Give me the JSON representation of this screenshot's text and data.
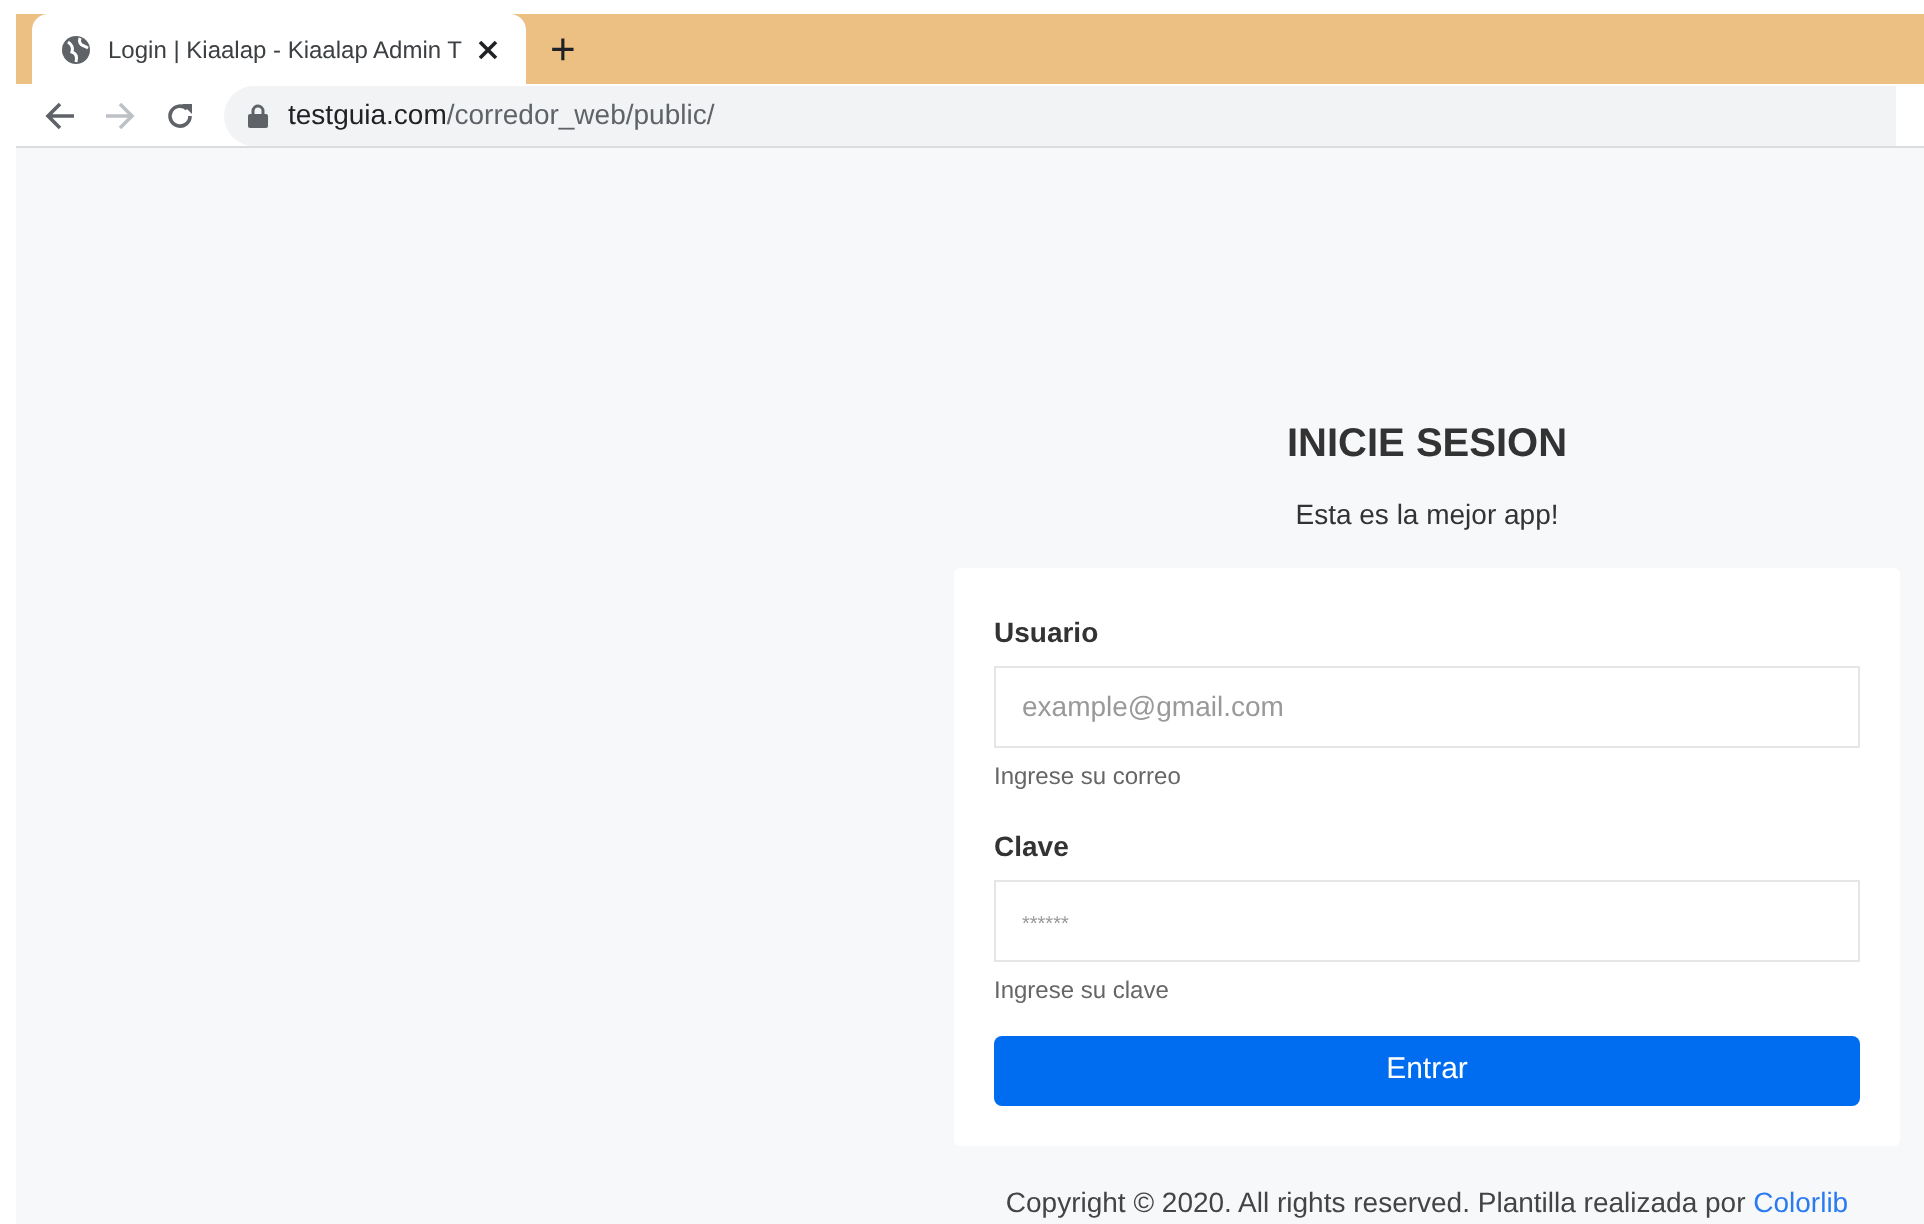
{
  "browser": {
    "tab": {
      "title": "Login | Kiaalap - Kiaalap Admin T",
      "selected": true
    },
    "new_tab": "+",
    "url": {
      "domain": "testguia.com",
      "path": "/corredor_web/public/"
    }
  },
  "login": {
    "title": "INICIE SESION",
    "subtitle": "Esta es la mejor app!",
    "fields": [
      {
        "label": "Usuario",
        "placeholder": "example@gmail.com",
        "hint": "Ingrese su correo",
        "kind": "email"
      },
      {
        "label": "Clave",
        "placeholder": "******",
        "hint": "Ingrese su clave",
        "kind": "password"
      }
    ],
    "submit": "Entrar"
  },
  "footer": {
    "text": "Copyright © 2020. All rights reserved. Plantilla realizada por",
    "link": "Colorlib"
  }
}
